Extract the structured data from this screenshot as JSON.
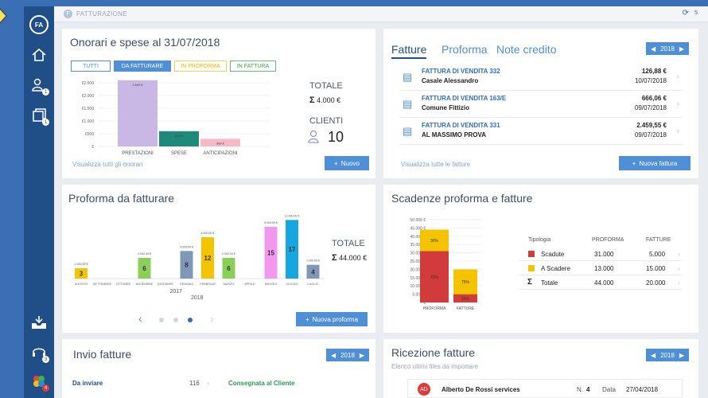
{
  "colors": {
    "sidebar": "#1f4f86",
    "accent": "#4e8fd6",
    "purple": "#c9b8e6",
    "teal": "#1f8a7a",
    "pink": "#f7b9c6",
    "yellow": "#f5c400",
    "green": "#8bcf5b",
    "steel": "#7f98b8",
    "magenta": "#f298ee",
    "cyan": "#17a7e0",
    "red": "#d23b3b"
  },
  "sidebar": {
    "avatar": "FA",
    "items": [
      {
        "icon": "home-icon"
      },
      {
        "icon": "clients-icon",
        "badge": "1"
      },
      {
        "icon": "documents-icon",
        "badge": "1"
      },
      {
        "icon": "inbox-tray-icon"
      },
      {
        "icon": "support-headset-icon",
        "badge": "3"
      },
      {
        "icon": "apps-icon",
        "badge": "4"
      }
    ]
  },
  "topbar": {
    "logo": "F",
    "title": "FATTURAZIONE",
    "sync_count": "5"
  },
  "onorari": {
    "title": "Onorari e spese al 31/07/2018",
    "filters": [
      "TUTTI",
      "DA FATTURARE",
      "IN PROFORMA",
      "IN FATTURA"
    ],
    "totale_label": "TOTALE",
    "totale_value": "4.000 €",
    "clienti_label": "CLIENTI",
    "clienti_value": "10",
    "link": "Visualizza tutti gli onorari",
    "button": "Nuovo"
  },
  "fatture": {
    "tabs": [
      "Fatture",
      "Proforma",
      "Note credito"
    ],
    "year": "2018",
    "rows": [
      {
        "title": "FATTURA DI VENDITA 332",
        "client": "Casale Alessandro",
        "amount": "126,88 €",
        "date": "10/07/2018"
      },
      {
        "title": "FATTURA DI VENDITA 163/E",
        "client": "Comune Fittizio",
        "amount": "666,06 €",
        "date": "09/07/2018"
      },
      {
        "title": "FATTURA DI VENDITA 331",
        "client": "AL MASSIMO PROVA",
        "amount": "2.459,55 €",
        "date": "09/07/2018"
      }
    ],
    "link": "Visualizza tutte le fatture",
    "button": "Nuova fattura"
  },
  "proforma": {
    "title": "Proforma da fatturare",
    "totale_label": "TOTALE",
    "totale_value": "44.000 €",
    "button": "Nuova proforma",
    "year_labels": [
      "2017",
      "2018"
    ]
  },
  "scadenze": {
    "title": "Scadenze proforma e fatture",
    "headers": [
      "Tipologia",
      "PROFORMA",
      "FATTURE"
    ],
    "rows": [
      {
        "label": "Scadute",
        "proforma": "31.000",
        "fatture": "5.000"
      },
      {
        "label": "A Scadere",
        "proforma": "13.000",
        "fatture": "15.000"
      },
      {
        "label": "Totale",
        "proforma": "44.000",
        "fatture": "20.000"
      }
    ]
  },
  "invio": {
    "title": "Invio fatture",
    "year": "2018",
    "row_label": "Da inviare",
    "row_count": "116",
    "status": "Consegnata al Cliente"
  },
  "ricezione": {
    "title": "Ricezione fatture",
    "subtitle": "Elenco ultimi files da importare",
    "year": "2018",
    "item": {
      "initials": "AD",
      "name": "Alberto De Rossi services",
      "n_label": "N.",
      "n_value": "4",
      "data_label": "Data",
      "date": "27/04/2018"
    }
  },
  "chart_data": [
    {
      "type": "bar",
      "title": "Onorari e spese al 31/07/2018",
      "categories": [
        "PRESTAZIONI",
        "SPESE",
        "ANTICIPAZIONI"
      ],
      "values": [
        2600,
        600,
        300
      ],
      "data_labels": [
        "2.600 €",
        "600 €",
        "300 €"
      ],
      "y_ticks": [
        "€2.500",
        "€2.000",
        "€1.500",
        "€1.000",
        "€500",
        "€"
      ],
      "ylim": [
        0,
        2500
      ],
      "colors": [
        "#c9b8e6",
        "#1f8a7a",
        "#f7b9c6"
      ]
    },
    {
      "type": "bar",
      "title": "Proforma da fatturare",
      "categories": [
        "AGOSTO",
        "SETTEMBRE",
        "OTTOBRE",
        "NOVEMBRE",
        "DICEMBRE",
        "GENNAIO",
        "FEBBRAIO",
        "MARZO",
        "APRILE",
        "MAGGIO",
        "GIUGNO",
        "LUGLIO"
      ],
      "counts": [
        3,
        null,
        null,
        6,
        null,
        8,
        12,
        6,
        null,
        15,
        17,
        4
      ],
      "values_label": [
        "1.000,00 €",
        "",
        "",
        "2.000,00 €",
        "",
        "4.000,00 €",
        "8.000,00 €",
        "2.000,00 €",
        "",
        "9.000,00 €",
        "12.000,00 €",
        "1.000,00 €"
      ],
      "colors": [
        "#f5c400",
        "",
        "",
        "#8bcf5b",
        "",
        "#7f98b8",
        "#f5c400",
        "#8bcf5b",
        "",
        "#f298ee",
        "#17a7e0",
        "#7f98b8"
      ],
      "x_groups": [
        "2017",
        "2018"
      ],
      "pager": {
        "pages": 3,
        "active": 3
      }
    },
    {
      "type": "bar",
      "title": "Scadenze proforma e fatture",
      "categories": [
        "PROFORMA",
        "FATTURE"
      ],
      "series": [
        {
          "name": "Scadute",
          "values": [
            31000,
            5000
          ],
          "color": "#d23b3b",
          "labels": [
            "70%",
            "25%"
          ]
        },
        {
          "name": "A Scadere",
          "values": [
            13000,
            15000
          ],
          "color": "#f5c400",
          "labels": [
            "30%",
            "75%"
          ]
        }
      ],
      "y_ticks": [
        "50.000 €",
        "45.000 €",
        "40.000 €",
        "35.000 €",
        "30.000 €",
        "25.000 €",
        "20.000 €",
        "15.000 €",
        "10.000 €",
        "5.000 €",
        "- €"
      ],
      "ylim": [
        0,
        50000
      ]
    }
  ]
}
